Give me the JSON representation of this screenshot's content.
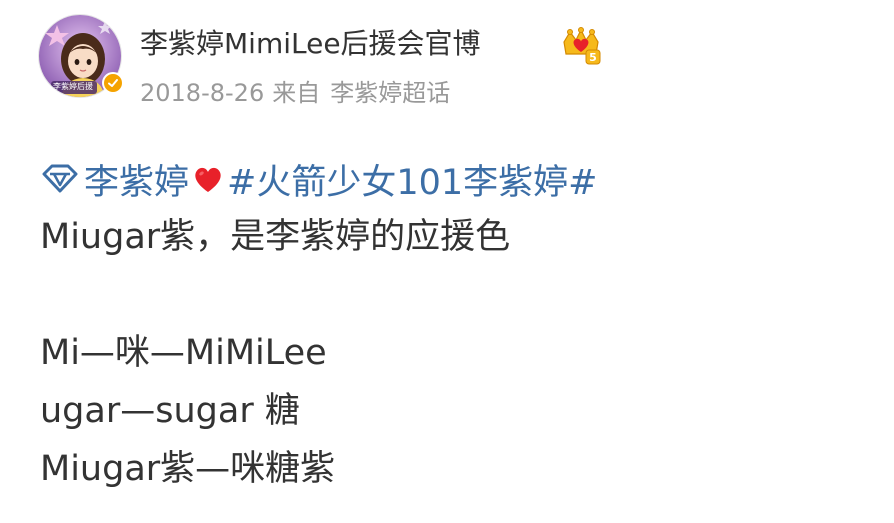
{
  "header": {
    "username": "李紫婷MimiLee后援会官博",
    "date": "2018-8-26",
    "via_text": "来自",
    "source": "李紫婷超话",
    "avatar_badge_text": "李紫婷后援",
    "crown_badge_level": "5"
  },
  "post": {
    "super_topic": "李紫婷",
    "hashtag": "#火箭少女101李紫婷#",
    "lines": [
      "Miugar紫，是李紫婷的应援色",
      "",
      "Mi—咪—MiMiLee",
      "ugar—sugar 糖",
      "Miugar紫—咪糖紫"
    ]
  },
  "colors": {
    "link": "#3c6ea6",
    "meta": "#999999",
    "text": "#333333",
    "verified": "#f5a300",
    "heart": "#e8212a"
  },
  "icons": {
    "verified": "verified-check-icon",
    "crown": "crown-level-icon",
    "super_topic": "diamond-icon",
    "heart": "heart-icon"
  }
}
